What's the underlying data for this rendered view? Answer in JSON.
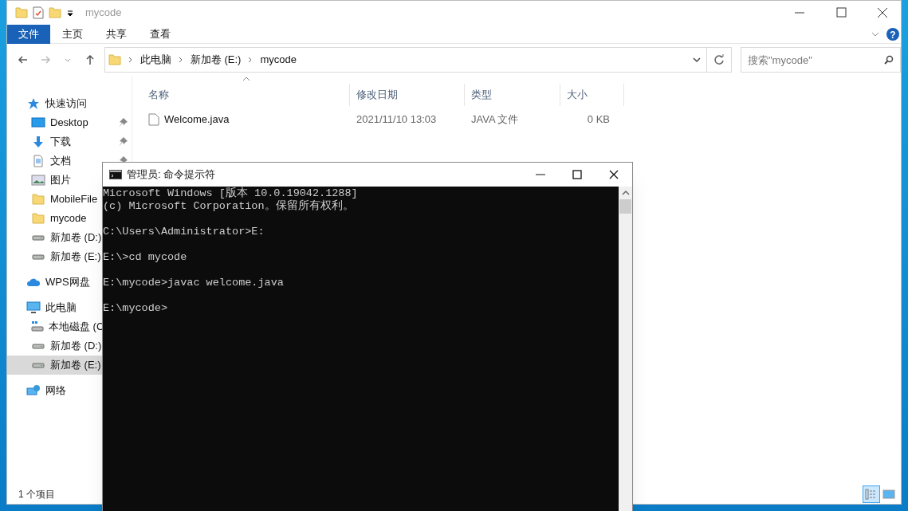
{
  "explorer": {
    "title": "mycode",
    "ribbon_tabs": [
      {
        "label": "文件",
        "selected": true
      },
      {
        "label": "主页",
        "selected": false
      },
      {
        "label": "共享",
        "selected": false
      },
      {
        "label": "查看",
        "selected": false
      }
    ],
    "breadcrumb": [
      "此电脑",
      "新加卷 (E:)",
      "mycode"
    ],
    "search": {
      "placeholder": "搜索\"mycode\""
    },
    "sidebar": [
      {
        "label": "快速访问",
        "kind": "star",
        "selected": false,
        "children": [
          {
            "label": "Desktop",
            "kind": "desktop",
            "pinned": true,
            "selected": false
          },
          {
            "label": "下载",
            "kind": "download",
            "pinned": true,
            "selected": false
          },
          {
            "label": "文档",
            "kind": "document",
            "pinned": true,
            "selected": false
          },
          {
            "label": "图片",
            "kind": "picture",
            "selected": false
          },
          {
            "label": "MobileFile",
            "kind": "folder",
            "selected": false
          },
          {
            "label": "mycode",
            "kind": "folder",
            "selected": false
          },
          {
            "label": "新加卷 (D:)",
            "kind": "drive",
            "selected": false
          },
          {
            "label": "新加卷 (E:)",
            "kind": "drive",
            "selected": false
          }
        ]
      },
      {
        "label": "WPS网盘",
        "kind": "cloud",
        "selected": false
      },
      {
        "label": "此电脑",
        "kind": "pc",
        "selected": false,
        "children": [
          {
            "label": "本地磁盘 (C",
            "kind": "sysdrive",
            "selected": false
          },
          {
            "label": "新加卷 (D:)",
            "kind": "drive",
            "selected": false
          },
          {
            "label": "新加卷 (E:)",
            "kind": "drive",
            "selected": true
          }
        ]
      },
      {
        "label": "网络",
        "kind": "network",
        "selected": false
      }
    ],
    "table": {
      "columns": [
        "名称",
        "修改日期",
        "类型",
        "大小"
      ],
      "rows": [
        [
          "Welcome.java",
          "2021/11/10 13:03",
          "JAVA 文件",
          "0 KB"
        ]
      ]
    },
    "status_bar": "1 个项目",
    "help": "?",
    "view_buttons": [
      {
        "kind": "details",
        "selected": true
      },
      {
        "kind": "thumbnails",
        "selected": false
      }
    ]
  },
  "console": {
    "title": "管理员: 命令提示符",
    "paragraphs": [
      [
        "Microsoft Windows [版本 10.0.19042.1288]",
        "(c) Microsoft Corporation。保留所有权利。"
      ],
      [
        "C:\\Users\\Administrator>E:"
      ],
      [
        "E:\\>cd mycode"
      ],
      [
        "E:\\mycode>javac welcome.java"
      ],
      [
        "E:\\mycode>"
      ]
    ]
  }
}
